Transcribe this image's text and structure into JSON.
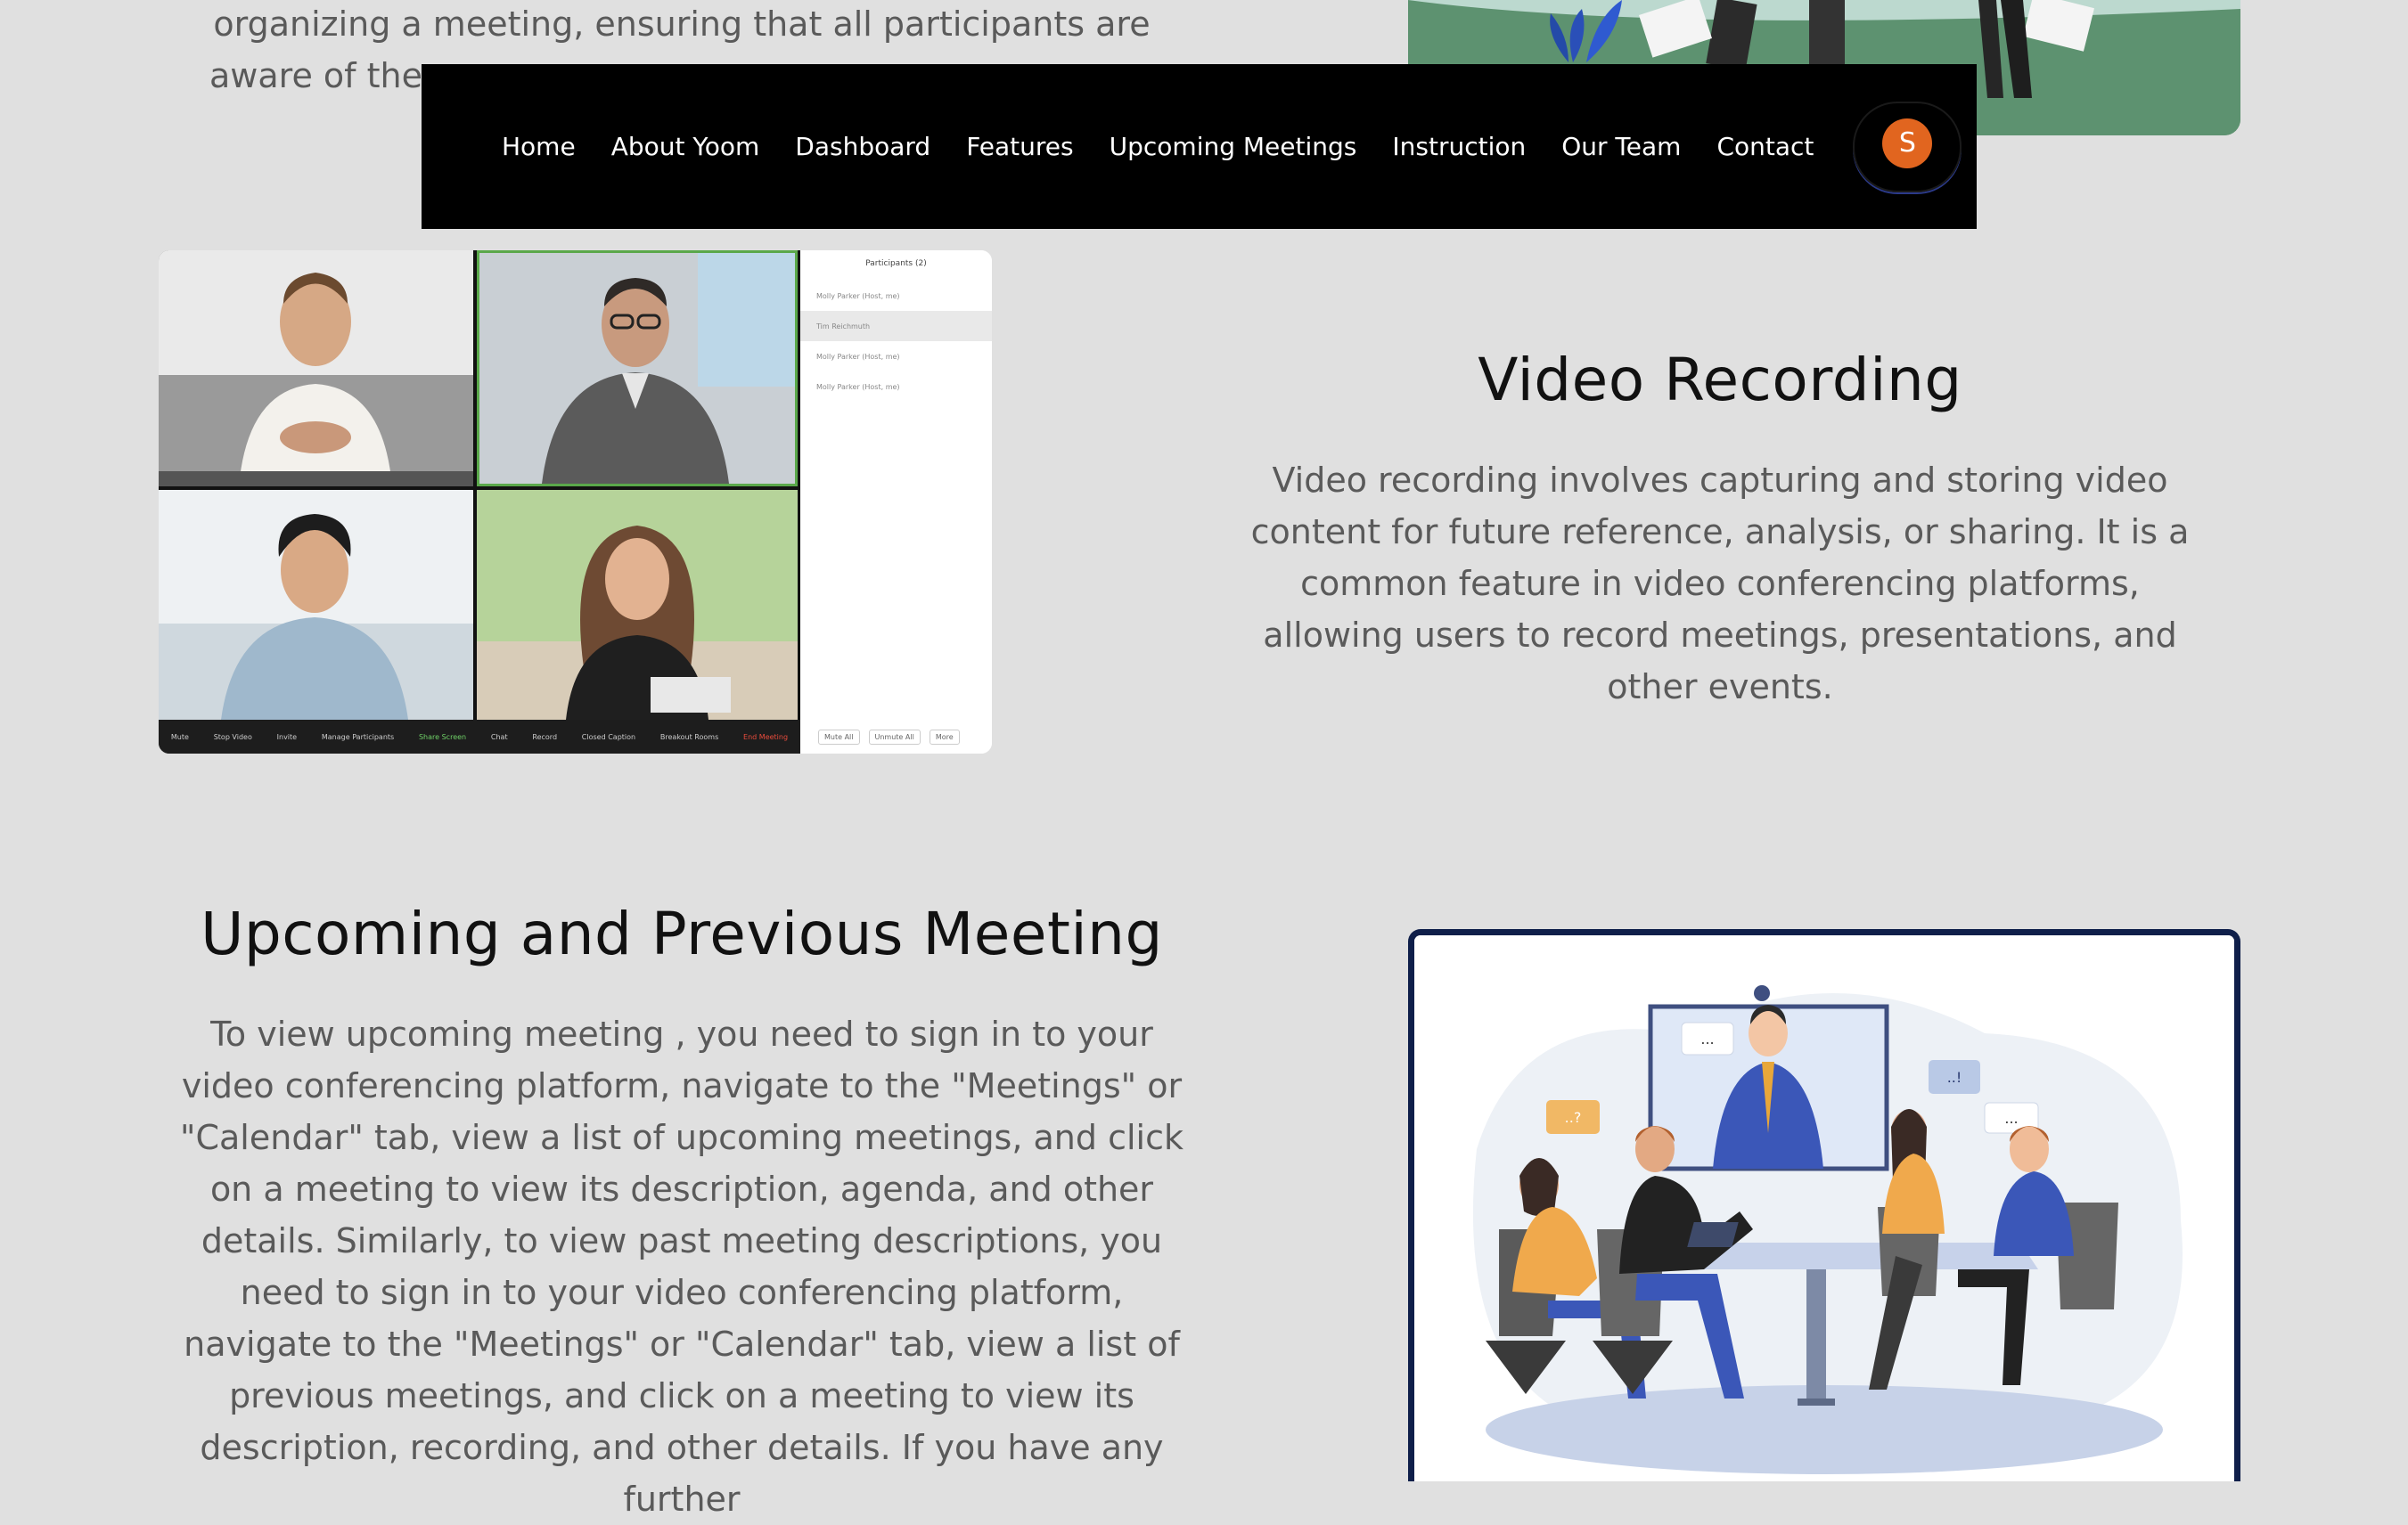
{
  "intro": {
    "line1": "organizing a meeting, ensuring that all participants are",
    "line2": "aware of the"
  },
  "nav": {
    "links": [
      "Home",
      "About Yoom",
      "Dashboard",
      "Features",
      "Upcoming Meetings",
      "Instruction",
      "Our Team",
      "Contact"
    ],
    "avatar_initial": "S",
    "avatar_color": "#e1651f"
  },
  "video_call": {
    "participants_title": "Participants (2)",
    "participants": [
      "Molly Parker (Host, me)",
      "Tim Reichmuth",
      "Molly Parker (Host, me)",
      "Molly Parker (Host, me)"
    ],
    "toolbar": [
      "Mute",
      "Stop Video",
      "Invite",
      "Manage Participants",
      "Share Screen",
      "Chat",
      "Record",
      "Closed Caption",
      "Breakout Rooms",
      "End Meeting"
    ],
    "panel_buttons": [
      "Mute All",
      "Unmute All",
      "More"
    ]
  },
  "recording": {
    "title": "Video Recording",
    "description": "Video recording involves capturing and storing video content for future reference, analysis, or sharing. It is a common feature in video conferencing platforms, allowing users to record meetings, presentations, and other events."
  },
  "upcoming": {
    "title": "Upcoming and Previous Meeting",
    "description": "To view upcoming meeting , you need to sign in to your video conferencing platform, navigate to the \"Meetings\" or \"Calendar\" tab, view a list of upcoming meetings, and click on a meeting to view its description, agenda, and other details. Similarly, to view past meeting descriptions, you need to sign in to your video conferencing platform, navigate to the \"Meetings\" or \"Calendar\" tab, view a list of previous meetings, and click on a meeting to view its description, recording, and other details. If you have any further"
  },
  "illustration": {
    "bubbles": [
      "...",
      "..?",
      "..!",
      "..."
    ]
  }
}
